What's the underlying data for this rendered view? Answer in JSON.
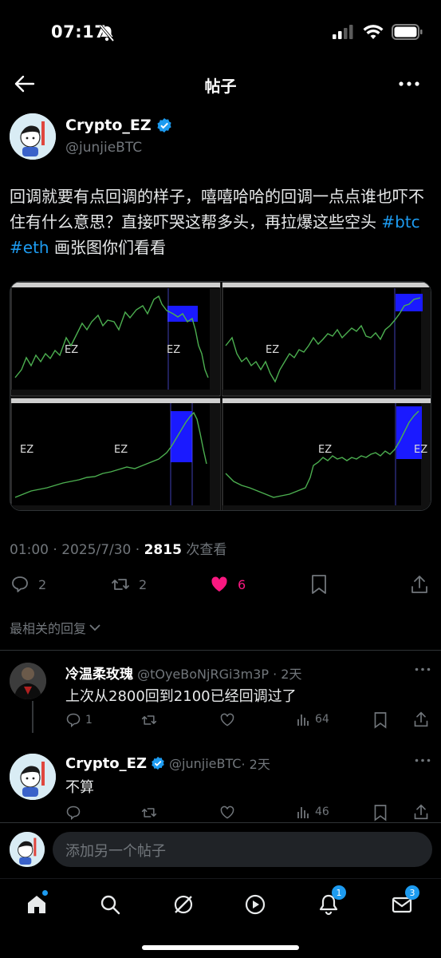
{
  "status": {
    "time": "07:17"
  },
  "header": {
    "title": "帖子"
  },
  "post": {
    "author": "Crypto_EZ",
    "handle": "@junjieBTC",
    "text_part1": "回调就要有点回调的样子，嘻嘻哈哈的回调一点点谁也吓不住有什么意思？直接吓哭这帮多头，再拉爆这些空头 ",
    "hashtag1": "#btc",
    "hashtag2": "#eth",
    "text_part2": " 画张图你们看看",
    "chart_watermark": "EZ",
    "time": "01:00 · 2025/7/30 · ",
    "views": "2815",
    "views_label": " 次查看",
    "replies": "2",
    "reposts": "2",
    "likes": "6",
    "like_color": "#f91880"
  },
  "sort_label": "最相关的回复",
  "replies": [
    {
      "name": "冷温柔玫瑰",
      "handle": "@tOyeBoNjRGi3m3P",
      "age": " · 2天",
      "text": "上次从2800回到2100已经回调过了",
      "reply_count": "1",
      "views": "64"
    },
    {
      "name": "Crypto_EZ",
      "handle": "@junjieBTC",
      "age": " · 2天",
      "text": "不算",
      "views": "46"
    }
  ],
  "composer": {
    "placeholder": "添加另一个帖子"
  },
  "tabbar": {
    "notifications_badge": "1",
    "messages_badge": "3"
  },
  "colors": {
    "accent": "#1d9bf0",
    "verified": "#1d9bf0"
  }
}
